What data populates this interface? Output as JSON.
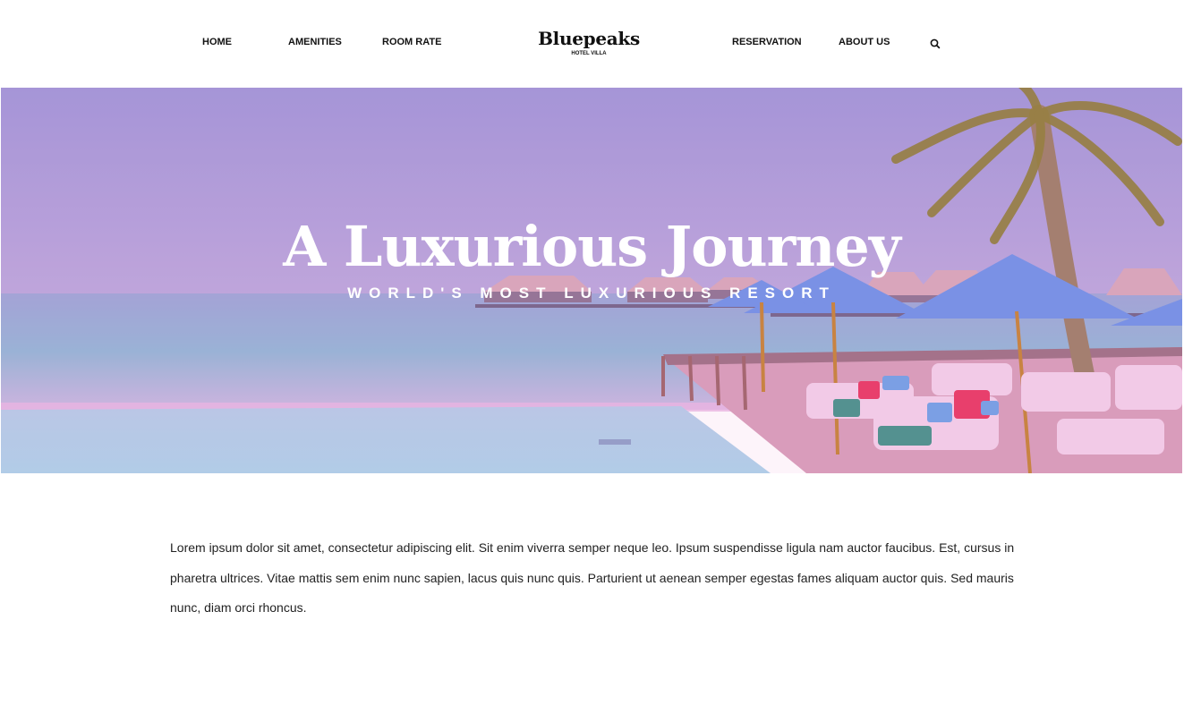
{
  "nav": {
    "left_links": [
      "HOME",
      "AMENITIES",
      "ROOM RATE"
    ],
    "right_links": [
      "RESERVATION",
      "ABOUT US"
    ],
    "logo": {
      "name": "Bluepeaks",
      "subtitle": "HOTEL VILLA"
    },
    "search_icon": "search-icon"
  },
  "hero": {
    "title": "A Luxurious Journey",
    "subtitle": "WORLD'S MOST LUXURIOUS RESORT"
  },
  "content": {
    "paragraph": "Lorem ipsum dolor sit amet, consectetur adipiscing elit. Sit enim viverra semper neque leo. Ipsum suspendisse ligula nam auctor faucibus. Est, cursus in pharetra ultrices. Vitae mattis sem enim nunc sapien, lacus quis nunc quis. Parturient ut aenean semper egestas fames aliquam auctor quis. Sed mauris nunc, diam orci rhoncus."
  },
  "colors": {
    "sky_top": "#9c93d8",
    "sky_bottom": "#b9a5dc",
    "sea": "#8fb4d6",
    "pool": "#a9cde6",
    "umbrella": "#6a8fe8",
    "pink_overlay": "#f2a6d8",
    "text": "#111111"
  }
}
